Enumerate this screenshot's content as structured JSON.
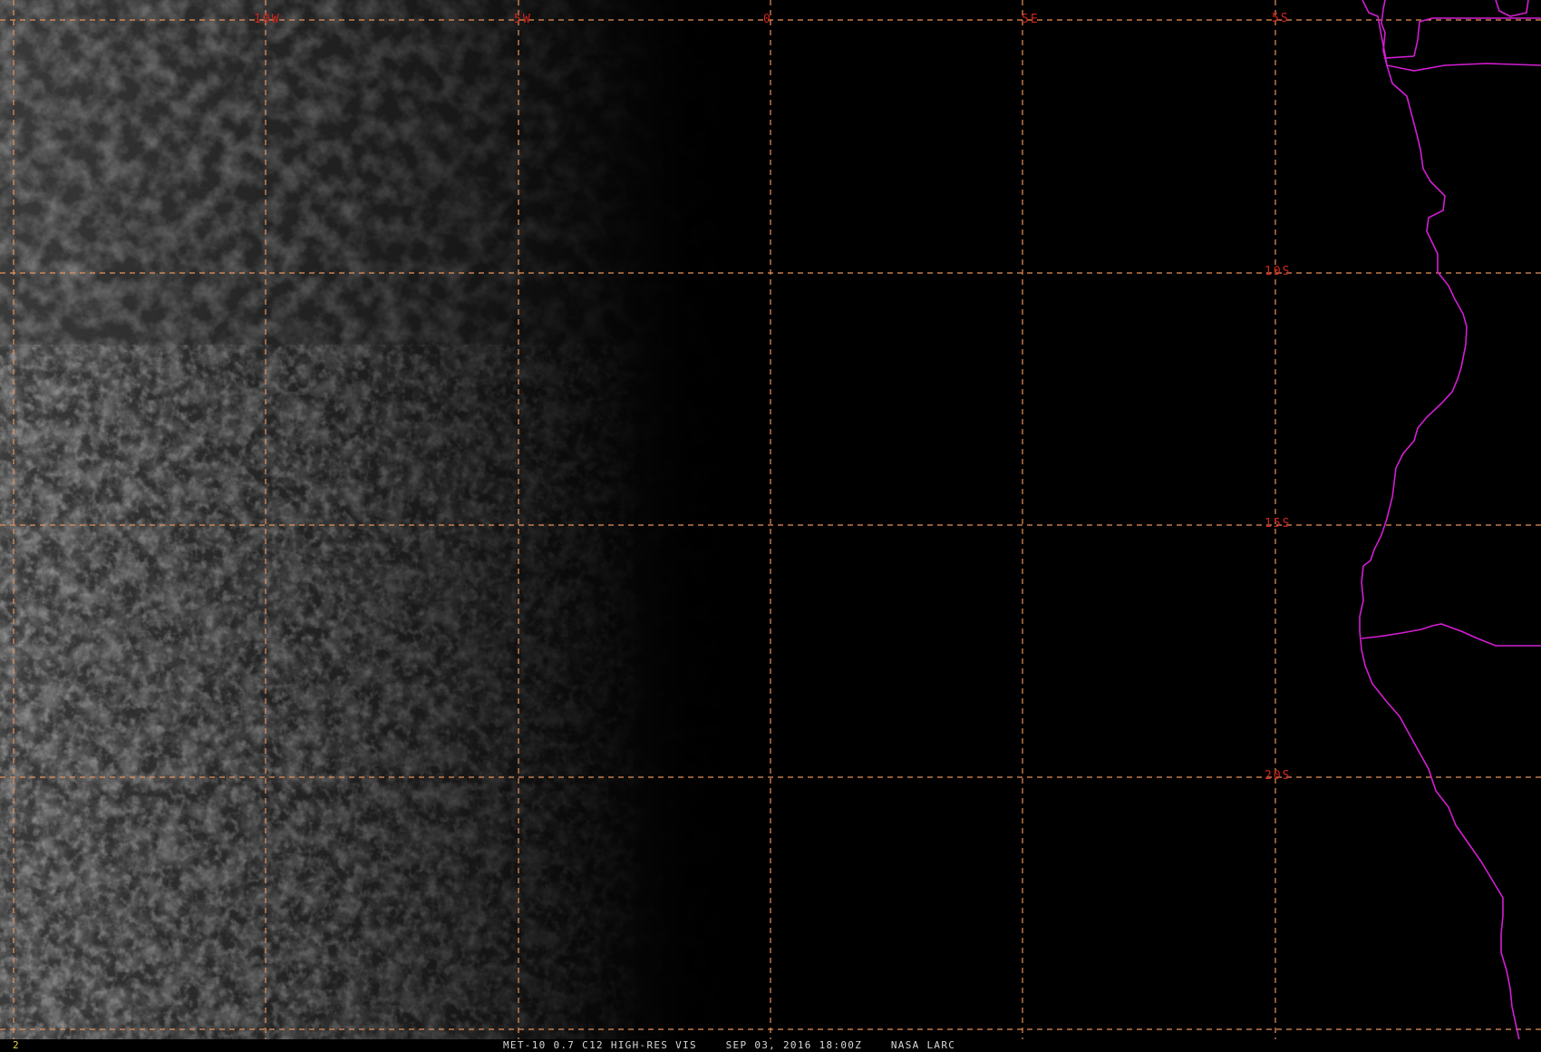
{
  "map": {
    "product": "MET-10 0.7 C12 HIGH-RES VIS",
    "timestamp": "SEP 03, 2016 18:00Z",
    "source": "NASA LARC",
    "frame_number": "2",
    "longitude_labels": [
      "10W",
      "5W",
      "0",
      "5E"
    ],
    "latitude_labels": [
      "5S",
      "10S",
      "15S",
      "20S"
    ],
    "colors": {
      "grid": "#e8925a",
      "grid_label": "#d2241e",
      "coastline": "#d21ed2",
      "caption": "#d8d8d8",
      "frame_number": "#e8d84a"
    }
  }
}
